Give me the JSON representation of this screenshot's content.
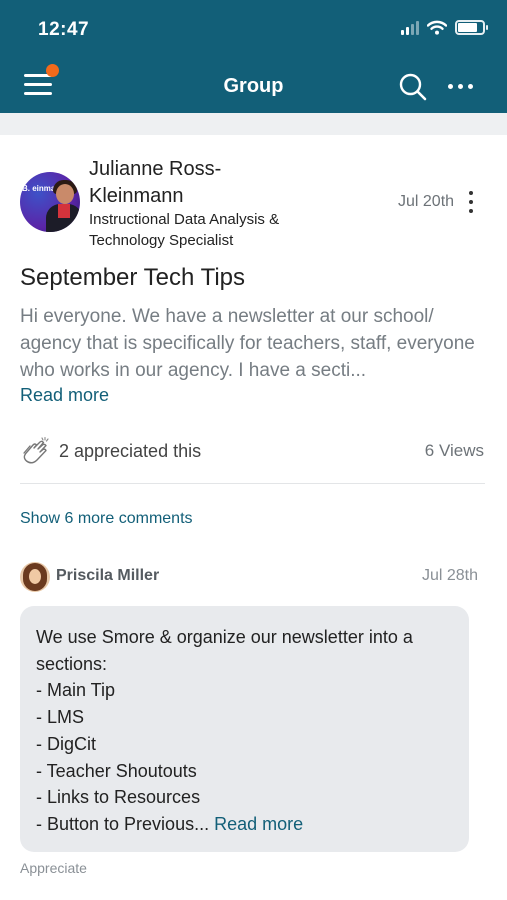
{
  "status_bar": {
    "time": "12:47"
  },
  "header": {
    "title": "Group"
  },
  "post": {
    "author_name": "Julianne Ross-Kleinmann",
    "author_role": "Instructional Data Analysis & Technology Specialist",
    "avatar_text": "B. einmann",
    "date": "Jul 20th",
    "title": "September Tech Tips",
    "body": "Hi everyone. We have a newsletter at our school/ agency that is specifically for teachers, staff, everyone who works in our agency. I have a secti...",
    "read_more": "Read more",
    "appreciated": "2 appreciated this",
    "views": "6 Views"
  },
  "comments": {
    "show_more": "Show 6 more comments",
    "items": [
      {
        "author": "Priscila Miller",
        "date": "Jul 28th",
        "lines": [
          "We use Smore & organize our newsletter into a",
          "sections:",
          "- Main Tip",
          "- LMS",
          "- DigCit",
          "- Teacher Shoutouts",
          "- Links to Resources"
        ],
        "last_line": "- Button to Previous...",
        "read_more": "Read more",
        "appreciate": "Appreciate"
      }
    ]
  },
  "colors": {
    "brand": "#125f78",
    "notification": "#f26a1b",
    "bubble": "#e8eaed"
  }
}
